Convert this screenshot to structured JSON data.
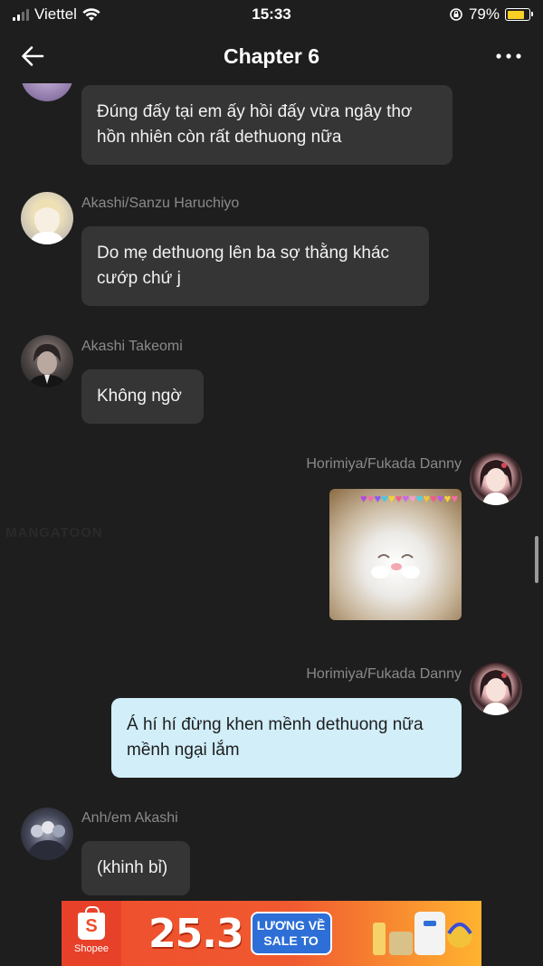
{
  "status_bar": {
    "carrier": "Viettel",
    "time": "15:33",
    "battery_percent": "79%",
    "battery_level": 0.79,
    "battery_color": "#f6d024"
  },
  "nav": {
    "title": "Chapter 6",
    "back_icon": "arrow-left-icon",
    "more_icon": "more-horizontal-icon"
  },
  "messages": [
    {
      "sender": "",
      "side": "left",
      "text": "Đúng đấy tại em ấy hồi đấy vừa ngây thơ hồn nhiên còn rất dethuong nữa"
    },
    {
      "sender": "Akashi/Sanzu Haruchiyo",
      "side": "left",
      "text": "Do mẹ dethuong lên ba sợ thằng khác cướp chứ j"
    },
    {
      "sender": "Akashi Takeomi",
      "side": "left",
      "text": "Không ngờ"
    },
    {
      "sender": "Horimiya/Fukada Danny",
      "side": "right",
      "type": "image",
      "image": "cat-with-hearts-sticker"
    },
    {
      "sender": "Horimiya/Fukada Danny",
      "side": "right",
      "text": "Á hí hí đừng khen mềnh dethuong nữa mềnh ngại lắm"
    },
    {
      "sender": "Anh/em Akashi",
      "side": "left",
      "text": "(khinh bỉ)"
    }
  ],
  "watermark": "MANGATOON",
  "ad_banner": {
    "brand": "Shopee",
    "date": "25.3",
    "promo_line1": "LƯƠNG VỀ",
    "promo_line2": "SALE TO",
    "colors": {
      "primary": "#ee4d2d",
      "accent": "#2d6fd6"
    }
  },
  "colors": {
    "background": "#1e1e1e",
    "bubble_other": "#353535",
    "bubble_me": "#d1eef9",
    "sender_name": "#8a8a8a"
  }
}
